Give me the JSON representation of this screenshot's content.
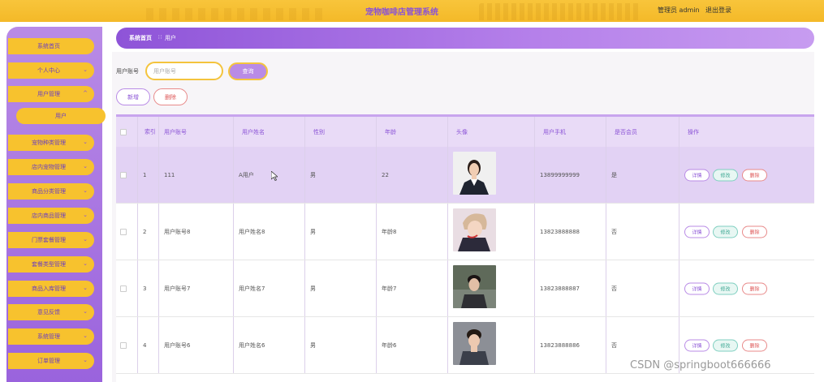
{
  "header": {
    "title": "宠物咖啡店管理系统",
    "admin_text": "管理员 admin",
    "logout_label": "退出登录"
  },
  "sidebar": {
    "items": [
      {
        "label": "系统首页",
        "has_chevron": false
      },
      {
        "label": "个人中心",
        "has_chevron": true
      },
      {
        "label": "用户管理",
        "has_chevron": true,
        "expanded": true
      },
      {
        "label": "宠物种类管理",
        "has_chevron": true
      },
      {
        "label": "店内宠物管理",
        "has_chevron": true
      },
      {
        "label": "商品分类管理",
        "has_chevron": true
      },
      {
        "label": "店内商品管理",
        "has_chevron": true
      },
      {
        "label": "门票套餐管理",
        "has_chevron": true
      },
      {
        "label": "套餐类型管理",
        "has_chevron": true
      },
      {
        "label": "商品入库管理",
        "has_chevron": true
      },
      {
        "label": "意见反馈",
        "has_chevron": true
      },
      {
        "label": "系统管理",
        "has_chevron": true
      },
      {
        "label": "订单管理",
        "has_chevron": true
      }
    ],
    "sub_item": "用户"
  },
  "breadcrumb": {
    "home": "系统首页",
    "separator": "∷",
    "current": "用户"
  },
  "search": {
    "label": "用户账号",
    "placeholder": "用户账号",
    "button": "查询"
  },
  "actions": {
    "add": "新增",
    "delete": "删除"
  },
  "table": {
    "headers": [
      "索引",
      "用户账号",
      "用户姓名",
      "性别",
      "年龄",
      "头像",
      "用户手机",
      "是否会员",
      "操作"
    ],
    "rows": [
      {
        "index": "1",
        "account": "111",
        "name": "A用户",
        "gender": "男",
        "age": "22",
        "phone": "13899999999",
        "member": "是"
      },
      {
        "index": "2",
        "account": "用户账号8",
        "name": "用户姓名8",
        "gender": "男",
        "age": "年龄8",
        "phone": "13823888888",
        "member": "否"
      },
      {
        "index": "3",
        "account": "用户账号7",
        "name": "用户姓名7",
        "gender": "男",
        "age": "年龄7",
        "phone": "13823888887",
        "member": "否"
      },
      {
        "index": "4",
        "account": "用户账号6",
        "name": "用户姓名6",
        "gender": "男",
        "age": "年龄6",
        "phone": "13823888886",
        "member": "否"
      }
    ],
    "op_labels": {
      "detail": "详情",
      "edit": "修改",
      "delete": "删除"
    }
  },
  "watermark": "CSDN @springboot666666",
  "colors": {
    "accent_purple": "#9a63dd",
    "accent_yellow": "#f7c22e"
  }
}
